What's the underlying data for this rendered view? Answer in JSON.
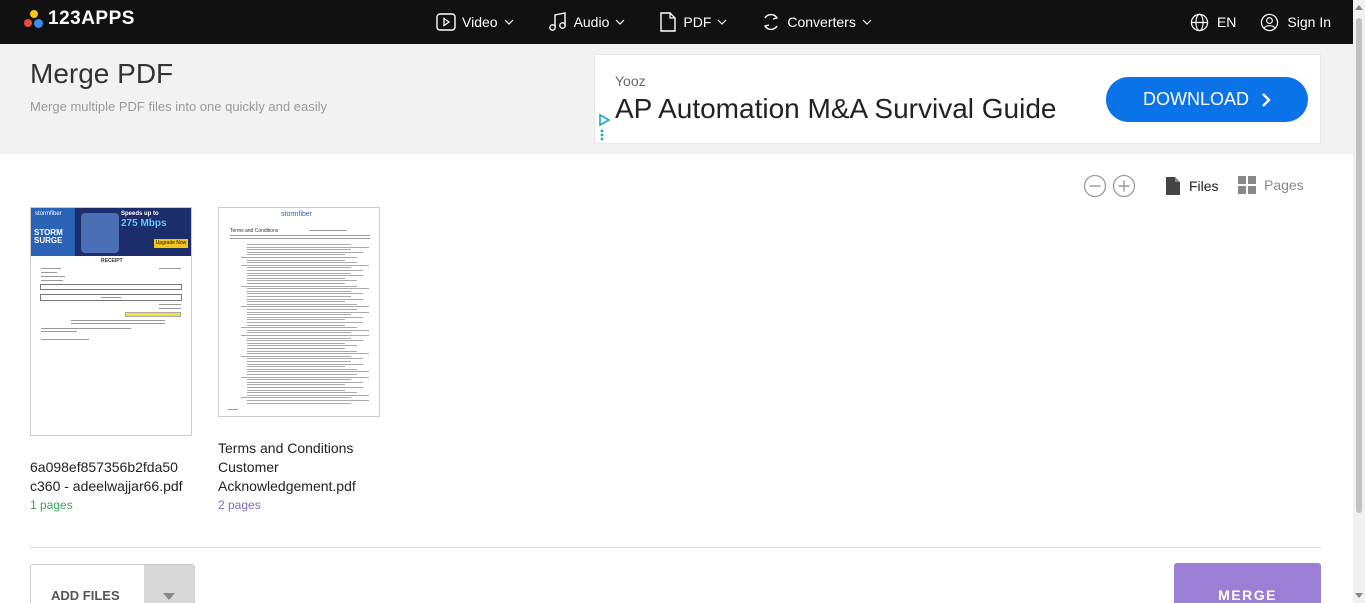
{
  "nav": {
    "logo_text": "123APPS",
    "items": [
      {
        "label": "Video",
        "icon": "video-icon"
      },
      {
        "label": "Audio",
        "icon": "music-icon"
      },
      {
        "label": "PDF",
        "icon": "file-icon"
      },
      {
        "label": "Converters",
        "icon": "convert-icon"
      }
    ],
    "language": "EN",
    "signin": "Sign In"
  },
  "header": {
    "title": "Merge PDF",
    "subtitle": "Merge multiple PDF files into one quickly and easily"
  },
  "ad": {
    "brand": "Yooz",
    "headline": "AP Automation M&A Survival Guide",
    "button": "DOWNLOAD"
  },
  "toolbar": {
    "files_label": "Files",
    "pages_label": "Pages"
  },
  "files": [
    {
      "name_line1": "6a098ef857356b2fda50",
      "name_line2": "c360 - adeelwajjar66.pdf",
      "pages": "1 pages",
      "pages_color": "#3aa35b"
    },
    {
      "name_line1": "Terms and Conditions",
      "name_line2": "Customer",
      "name_line3": "Acknowledgement.pdf",
      "pages": "2 pages",
      "pages_color": "#7b6cc4"
    }
  ],
  "thumb1": {
    "banner_brand": "stormfiber",
    "banner_line1": "Speeds up to",
    "banner_speed": "275 Mbps",
    "banner_tag": "STORM SURGE",
    "banner_cta": "Upgrade Now",
    "doc_title": "RECEIPT"
  },
  "thumb2": {
    "brand": "stormfiber",
    "doc_title": "Terms and Conditions"
  },
  "actions": {
    "add_files": "ADD FILES",
    "merge": "MERGE"
  },
  "colors": {
    "accent_purple": "#9a7fd4",
    "ad_blue": "#0a73e8"
  }
}
